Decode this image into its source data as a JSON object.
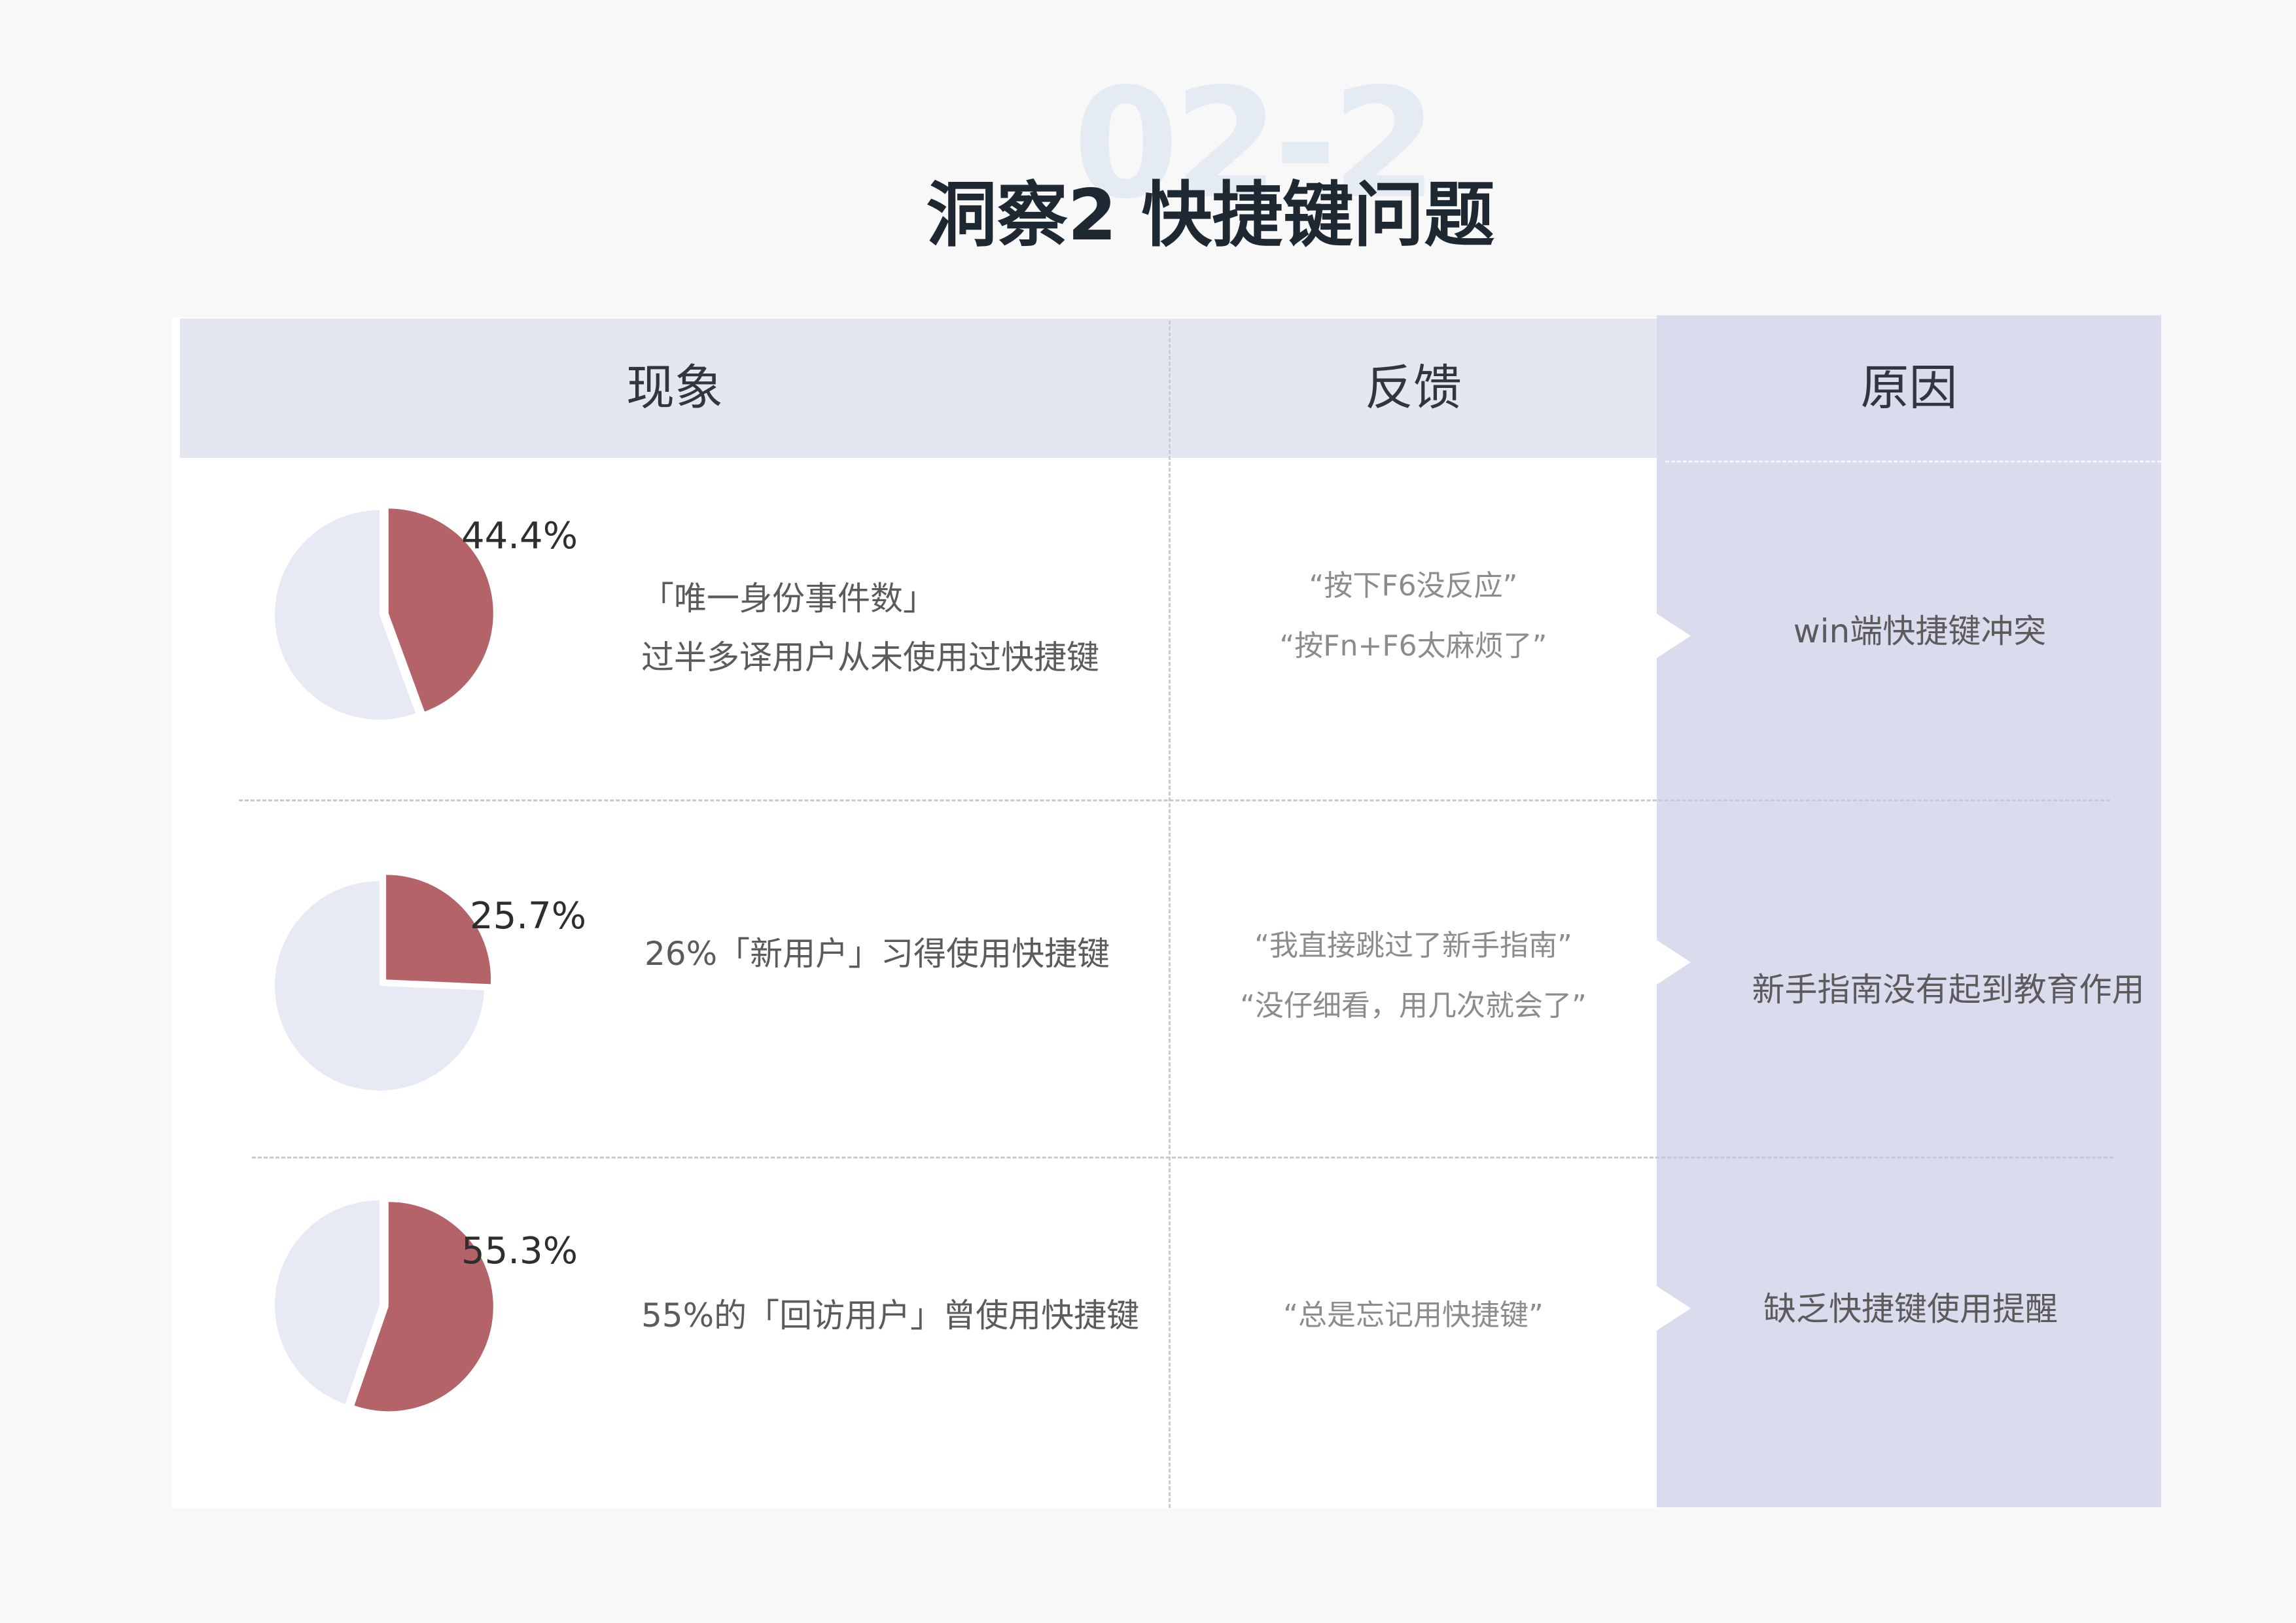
{
  "header": {
    "section_number": "02-2",
    "title": "洞察2 快捷键问题"
  },
  "columns": {
    "phenomenon": "现象",
    "feedback": "反馈",
    "reason": "原因"
  },
  "colors": {
    "highlight": "#b46368",
    "remainder": "#e7e9f4",
    "header_bg": "#e4e7f1",
    "reason_bg": "#dadced"
  },
  "rows": [
    {
      "phenomenon_lines": [
        "「唯一身份事件数」",
        "过半多译用户从未使用过快捷键"
      ],
      "feedback_lines": [
        "“按下F6没反应”",
        "“按Fn+F6太麻烦了”"
      ],
      "reason": "win端快捷键冲突"
    },
    {
      "phenomenon_lines": [
        "26%「新用户」习得使用快捷键"
      ],
      "feedback_lines": [
        "“我直接跳过了新手指南”",
        "“没仔细看，用几次就会了”"
      ],
      "reason": "新手指南没有起到教育作用"
    },
    {
      "phenomenon_lines": [
        "55%的「回访用户」曾使用快捷键"
      ],
      "feedback_lines": [
        "“总是忘记用快捷键”"
      ],
      "reason": "缺乏快捷键使用提醒"
    }
  ],
  "chart_data": [
    {
      "type": "pie",
      "labels": [
        "",
        ""
      ],
      "values": [
        44.4,
        55.6
      ],
      "data_labels": [
        "44.4%"
      ]
    },
    {
      "type": "pie",
      "labels": [
        "",
        ""
      ],
      "values": [
        25.7,
        74.3
      ],
      "data_labels": [
        "25.7%"
      ]
    },
    {
      "type": "pie",
      "labels": [
        "",
        ""
      ],
      "values": [
        55.3,
        44.7
      ],
      "data_labels": [
        "55.3%"
      ]
    }
  ]
}
